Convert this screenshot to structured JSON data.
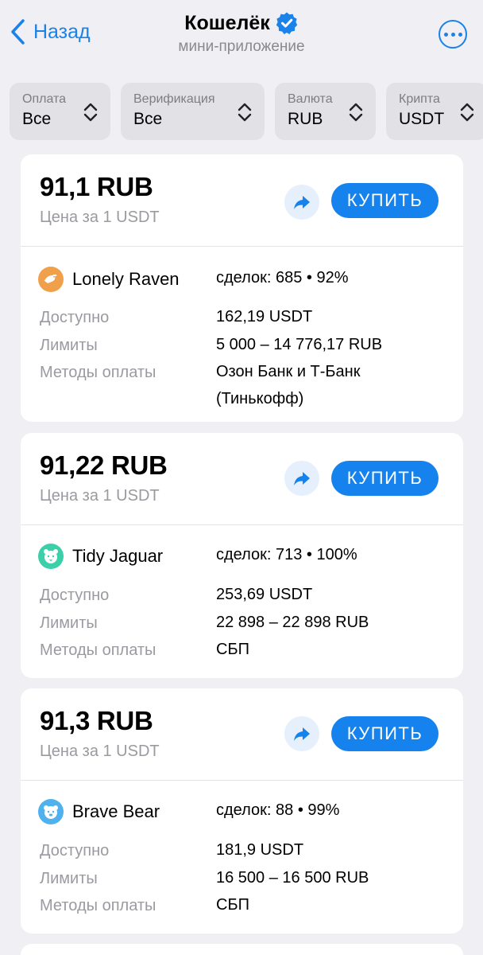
{
  "header": {
    "back_label": "Назад",
    "title": "Кошелёк",
    "subtitle": "мини-приложение",
    "accent_color": "#1a82e8"
  },
  "filters": [
    {
      "label": "Оплата",
      "value": "Все"
    },
    {
      "label": "Верификация",
      "value": "Все"
    },
    {
      "label": "Валюта",
      "value": "RUB"
    },
    {
      "label": "Крипта",
      "value": "USDT"
    }
  ],
  "offers": [
    {
      "price": "91,1 RUB",
      "price_sub": "Цена за 1 USDT",
      "buy_label": "КУПИТЬ",
      "seller": "Lonely Raven",
      "avatar_color": "#f0a04a",
      "avatar_icon": "raven-icon",
      "deals": "сделок: 685 • 92%",
      "available_label": "Доступно",
      "available": "162,19 USDT",
      "limits_label": "Лимиты",
      "limits": "5 000 – 14 776,17 RUB",
      "methods_label": "Методы оплаты",
      "methods_line1": "Озон Банк и Т-Банк",
      "methods_line2": "(Тинькофф)"
    },
    {
      "price": "91,22 RUB",
      "price_sub": "Цена за 1 USDT",
      "buy_label": "КУПИТЬ",
      "seller": "Tidy Jaguar",
      "avatar_color": "#3cd0a8",
      "avatar_icon": "jaguar-icon",
      "deals": "сделок: 713 • 100%",
      "available_label": "Доступно",
      "available": "253,69 USDT",
      "limits_label": "Лимиты",
      "limits": "22 898 – 22 898 RUB",
      "methods_label": "Методы оплаты",
      "methods_line1": "СБП"
    },
    {
      "price": "91,3 RUB",
      "price_sub": "Цена за 1 USDT",
      "buy_label": "КУПИТЬ",
      "seller": "Brave Bear",
      "avatar_color": "#4fb2ee",
      "avatar_icon": "bear-icon",
      "deals": "сделок: 88 • 99%",
      "available_label": "Доступно",
      "available": "181,9 USDT",
      "limits_label": "Лимиты",
      "limits": "16 500 – 16 500 RUB",
      "methods_label": "Методы оплаты",
      "methods_line1": "СБП"
    }
  ]
}
